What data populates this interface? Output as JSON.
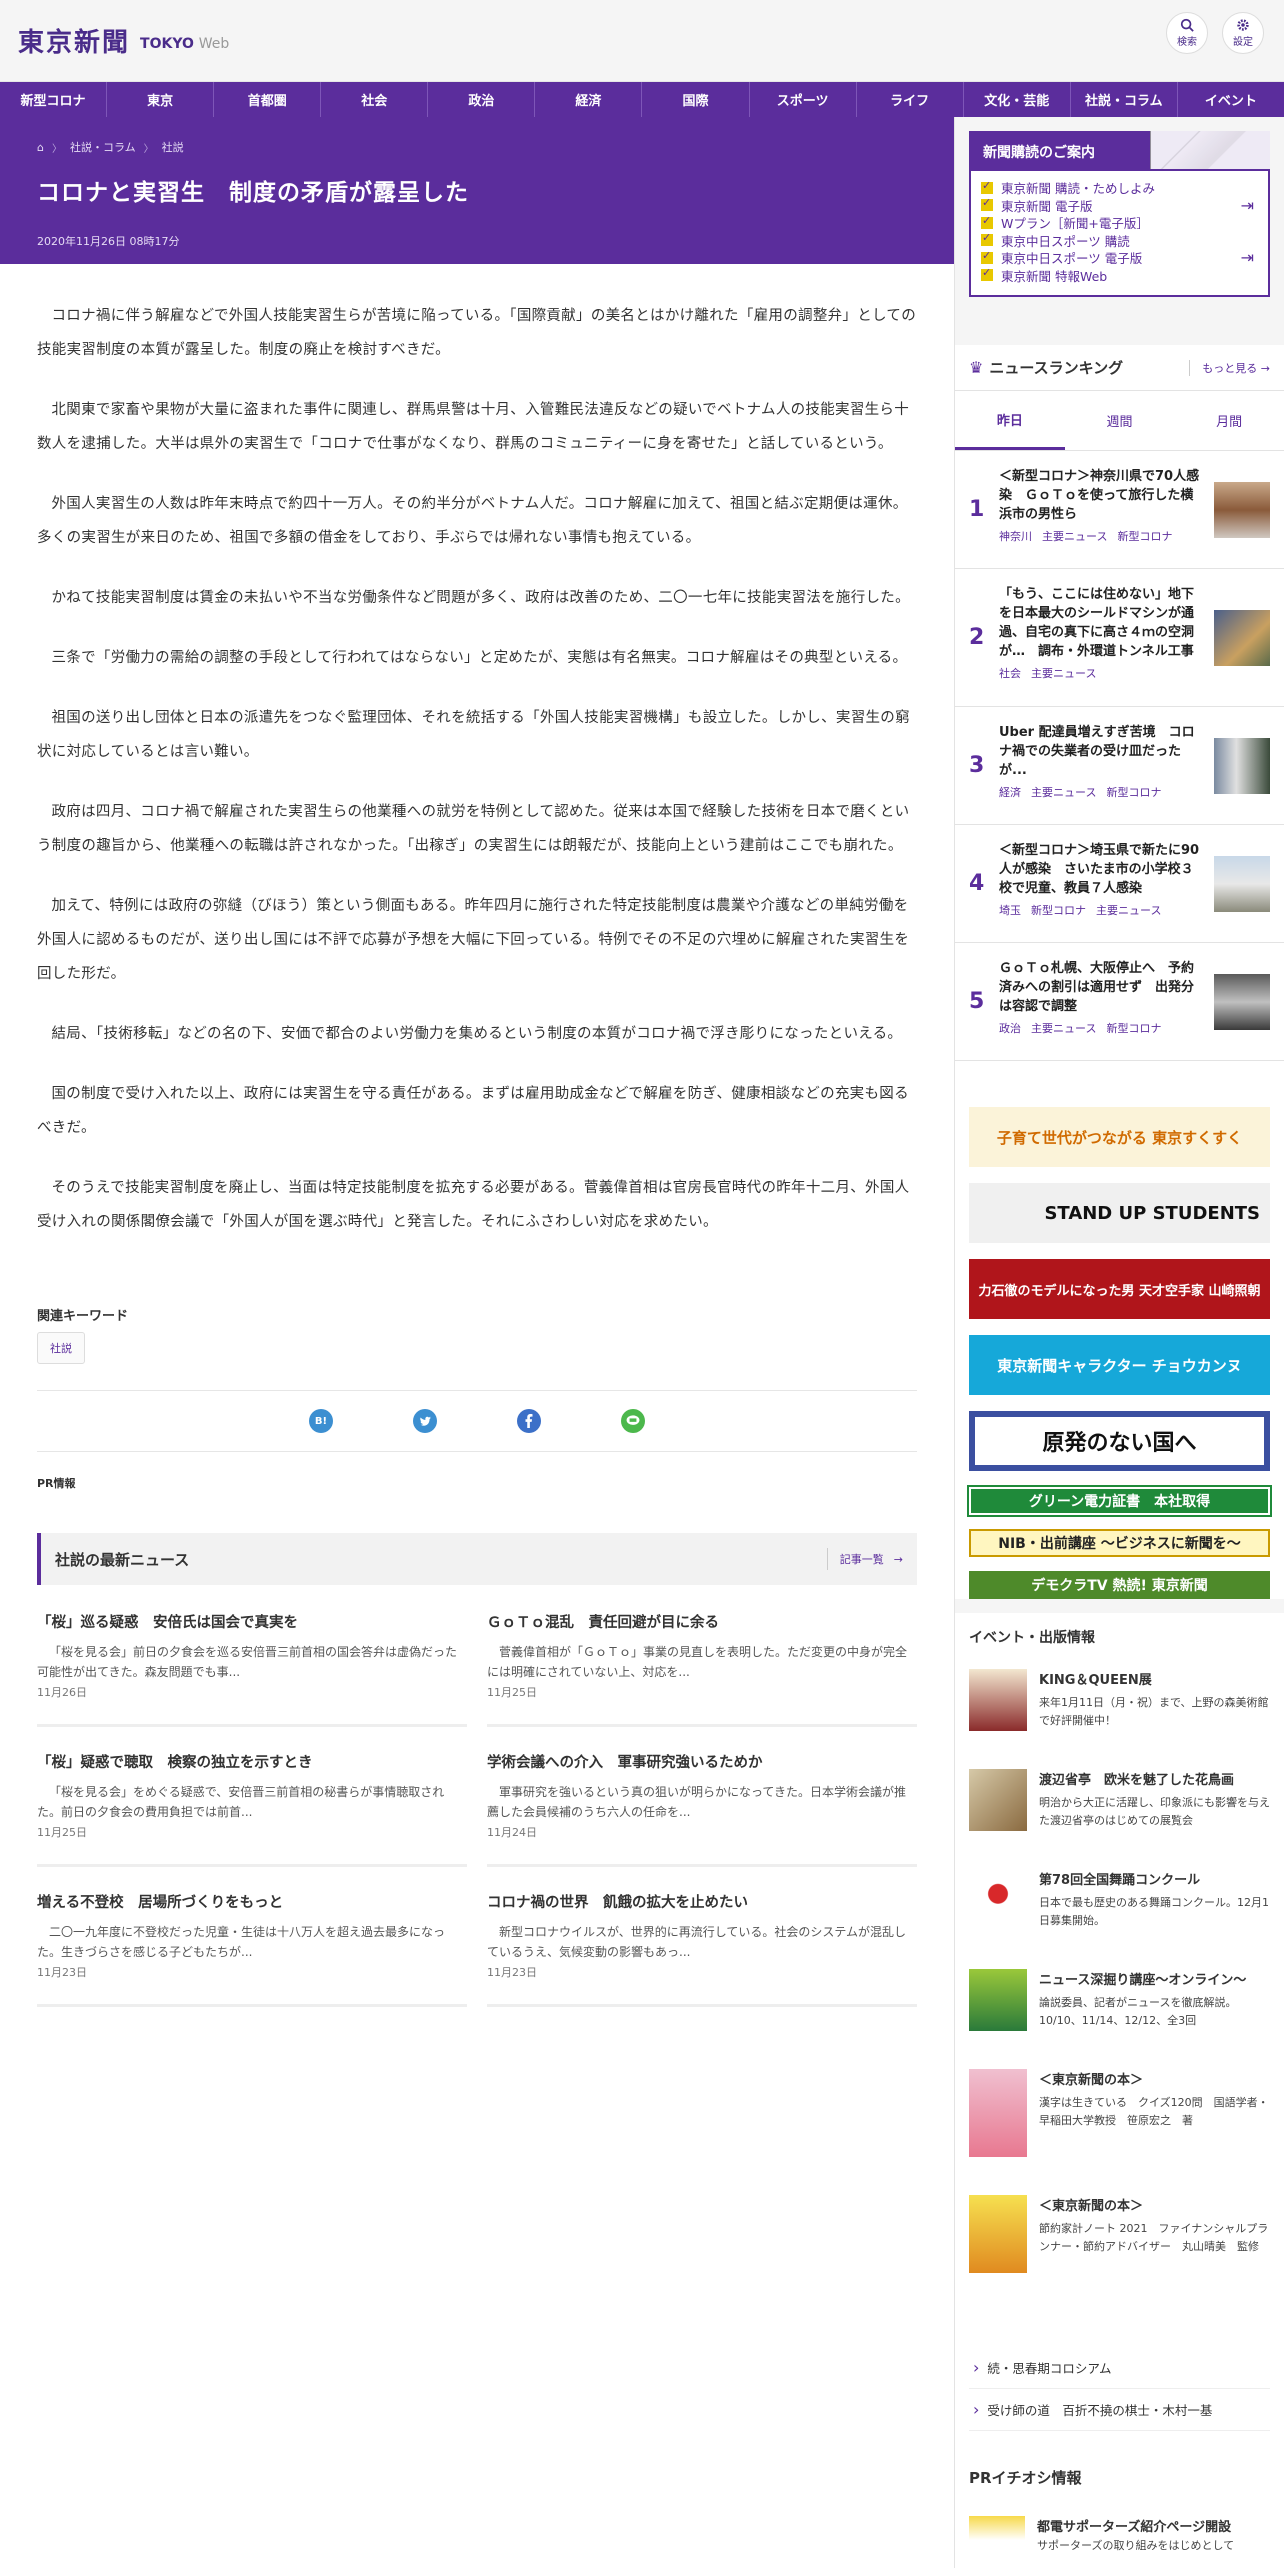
{
  "header": {
    "logo": "東京新聞",
    "logo_sub": "TOKYO",
    "logo_web": "Web",
    "search_label": "検索",
    "settings_label": "設定"
  },
  "nav": [
    "新型コロナ",
    "東京",
    "首都圏",
    "社会",
    "政治",
    "経済",
    "国際",
    "スポーツ",
    "ライフ",
    "文化・芸能",
    "社説・コラム",
    "イベント"
  ],
  "breadcrumb": {
    "home": "⌂",
    "cat": "社説・コラム",
    "sub": "社説"
  },
  "article": {
    "title": "コロナと実習生　制度の矛盾が露呈した",
    "date": "2020年11月26日 08時17分",
    "paragraphs": [
      "コロナ禍に伴う解雇などで外国人技能実習生らが苦境に陥っている。「国際貢献」の美名とはかけ離れた「雇用の調整弁」としての技能実習制度の本質が露呈した。制度の廃止を検討すべきだ。",
      "北関東で家畜や果物が大量に盗まれた事件に関連し、群馬県警は十月、入管難民法違反などの疑いでベトナム人の技能実習生ら十数人を逮捕した。大半は県外の実習生で「コロナで仕事がなくなり、群馬のコミュニティーに身を寄せた」と話しているという。",
      "外国人実習生の人数は昨年末時点で約四十一万人。その約半分がベトナム人だ。コロナ解雇に加えて、祖国と結ぶ定期便は運休。多くの実習生が来日のため、祖国で多額の借金をしており、手ぶらでは帰れない事情も抱えている。",
      "かねて技能実習制度は賃金の未払いや不当な労働条件など問題が多く、政府は改善のため、二〇一七年に技能実習法を施行した。",
      "三条で「労働力の需給の調整の手段として行われてはならない」と定めたが、実態は有名無実。コロナ解雇はその典型といえる。",
      "祖国の送り出し団体と日本の派遣先をつなぐ監理団体、それを統括する「外国人技能実習機構」も設立した。しかし、実習生の窮状に対応しているとは言い難い。",
      "政府は四月、コロナ禍で解雇された実習生らの他業種への就労を特例として認めた。従来は本国で経験した技術を日本で磨くという制度の趣旨から、他業種への転職は許されなかった。「出稼ぎ」の実習生には朗報だが、技能向上という建前はここでも崩れた。",
      "加えて、特例には政府の弥縫（びほう）策という側面もある。昨年四月に施行された特定技能制度は農業や介護などの単純労働を外国人に認めるものだが、送り出し国には不評で応募が予想を大幅に下回っている。特例でその不足の穴埋めに解雇された実習生を回した形だ。",
      "結局、「技術移転」などの名の下、安価で都合のよい労働力を集めるという制度の本質がコロナ禍で浮き彫りになったといえる。",
      "国の制度で受け入れた以上、政府には実習生を守る責任がある。まずは雇用助成金などで解雇を防ぎ、健康相談などの充実も図るべきだ。",
      "そのうえで技能実習制度を廃止し、当面は特定技能制度を拡充する必要がある。菅義偉首相は官房長官時代の昨年十二月、外国人受け入れの関係閣僚会議で「外国人が国を選ぶ時代」と発言した。それにふさわしい対応を求めたい。"
    ]
  },
  "keywords": {
    "title": "関連キーワード",
    "tag": "社説"
  },
  "share": {
    "hatena": "B!"
  },
  "pr_label": "PR情報",
  "latest": {
    "title": "社説の最新ニュース",
    "more": "記事一覧",
    "items": [
      {
        "title": "「桜」巡る疑惑　安倍氏は国会で真実を",
        "excerpt": "「桜を見る会」前日の夕食会を巡る安倍晋三前首相の国会答弁は虚偽だった可能性が出てきた。森友問題でも事...",
        "date": "11月26日"
      },
      {
        "title": "ＧｏＴｏ混乱　責任回避が目に余る",
        "excerpt": "菅義偉首相が「ＧｏＴｏ」事業の見直しを表明した。ただ変更の中身が完全には明確にされていない上、対応を...",
        "date": "11月25日"
      },
      {
        "title": "「桜」疑惑で聴取　検察の独立を示すとき",
        "excerpt": "「桜を見る会」をめぐる疑惑で、安倍晋三前首相の秘書らが事情聴取された。前日の夕食会の費用負担では前首...",
        "date": "11月25日"
      },
      {
        "title": "学術会議への介入　軍事研究強いるためか",
        "excerpt": "軍事研究を強いるという真の狙いが明らかになってきた。日本学術会議が推薦した会員候補のうち六人の任命を...",
        "date": "11月24日"
      },
      {
        "title": "増える不登校　居場所づくりをもっと",
        "excerpt": "二〇一九年度に不登校だった児童・生徒は十八万人を超え過去最多になった。生きづらさを感じる子どもたちが...",
        "date": "11月23日"
      },
      {
        "title": "コロナ禍の世界　飢餓の拡大を止めたい",
        "excerpt": "新型コロナウイルスが、世界的に再流行している。社会のシステムが混乱しているうえ、気候変動の影響もあっ...",
        "date": "11月23日"
      }
    ]
  },
  "subscribe": {
    "title": "新聞購読のご案内",
    "items": [
      "東京新聞 購読・ためしよみ",
      "東京新聞 電子版",
      "Wプラン［新聞+電子版］",
      "東京中日スポーツ 購読",
      "東京中日スポーツ 電子版",
      "東京新聞 特報Web"
    ]
  },
  "ranking": {
    "title": "ニュースランキング",
    "more": "もっと見る",
    "tabs": [
      "昨日",
      "週間",
      "月間"
    ],
    "items": [
      {
        "n": "1",
        "title": "＜新型コロナ＞神奈川県で70人感染　ＧｏＴｏを使って旅行した横浜市の男性ら",
        "tags": [
          "神奈川",
          "主要ニュース",
          "新型コロナ"
        ]
      },
      {
        "n": "2",
        "title": "「もう、ここには住めない」地下を日本最大のシールドマシンが通過、自宅の真下に高さ４ｍの空洞が…　調布・外環道トンネル工事",
        "tags": [
          "社会",
          "主要ニュース"
        ]
      },
      {
        "n": "3",
        "title": "Uber 配達員増えすぎ苦境　コロナ禍での失業者の受け皿だったが...",
        "tags": [
          "経済",
          "主要ニュース",
          "新型コロナ"
        ]
      },
      {
        "n": "4",
        "title": "＜新型コロナ＞埼玉県で新たに90人が感染　さいたま市の小学校３校で児童、教員７人感染",
        "tags": [
          "埼玉",
          "新型コロナ",
          "主要ニュース"
        ]
      },
      {
        "n": "5",
        "title": "ＧｏＴｏ札幌、大阪停止へ　予約済みへの割引は適用せず　出発分は容認で調整",
        "tags": [
          "政治",
          "主要ニュース",
          "新型コロナ"
        ]
      }
    ]
  },
  "banners": {
    "b1": "子育て世代がつながる 東京すくすく",
    "b2": "STAND UP STUDENTS",
    "b3": "力石徹のモデルになった男 天才空手家 山崎照朝",
    "b4": "東京新聞キャラクター チョウカンヌ",
    "b5": "原発のない国へ",
    "b6": "グリーン電力証書　本社取得",
    "b7": "NIB・出前講座 ～ビジネスに新聞を～",
    "b8": "デモクラTV 熱読! 東京新聞"
  },
  "events": {
    "title": "イベント・出版情報",
    "items": [
      {
        "title": "KING＆QUEEN展",
        "text": "来年1月11日（月・祝）まで、上野の森美術館で好評開催中！"
      },
      {
        "title": "渡辺省亭　欧米を魅了した花鳥画",
        "text": "明治から大正に活躍し、印象派にも影響を与えた渡辺省亭のはじめての展覧会"
      },
      {
        "title": "第78回全国舞踊コンクール",
        "text": "日本で最も歴史のある舞踊コンクール。12月1日募集開始。"
      },
      {
        "title": "ニュース深掘り講座～オンライン～",
        "text": "論説委員、記者がニュースを徹底解説。10/10、11/14、12/12、全3回"
      },
      {
        "title": "＜東京新聞の本＞",
        "text": "漢字は生きている　クイズ120問　国語学者・早稲田大学教授　笹原宏之　著"
      },
      {
        "title": "＜東京新聞の本＞",
        "text": "節約家計ノート 2021　ファイナンシャルプランナー・節約アドバイザー　丸山晴美　監修"
      }
    ]
  },
  "links": [
    "続・思春期コロシアム",
    "受け師の道　百折不撓の棋士・木村一基"
  ],
  "pr_pick": {
    "title": "PRイチオシ情報",
    "item_title": "都電サポーターズ紹介ページ開設",
    "item_text": "サポーターズの取り組みをはじめとして"
  }
}
